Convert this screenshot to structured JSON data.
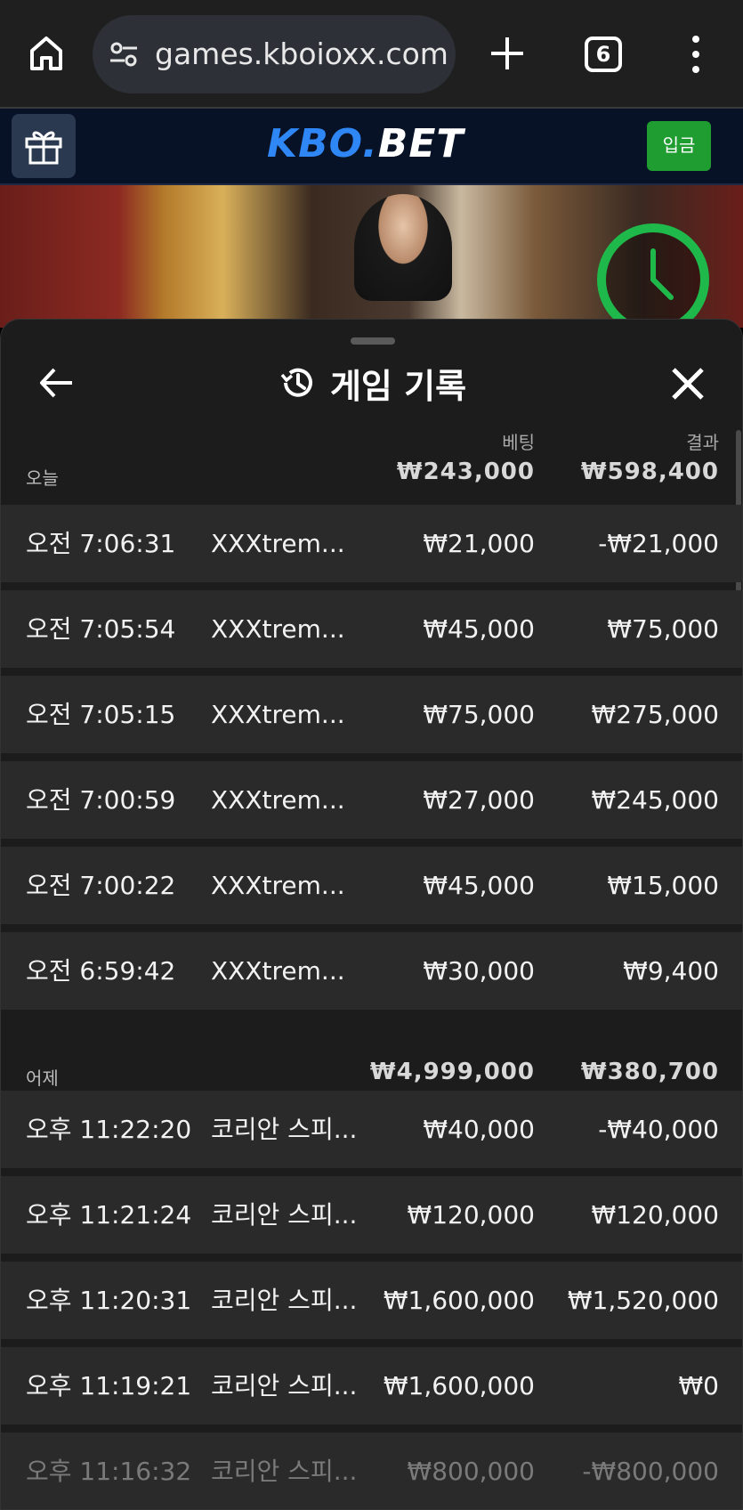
{
  "browser": {
    "url": "games.kboioxx.com/",
    "tab_count": "6"
  },
  "site": {
    "logo_part1": "KBO",
    "logo_dot": ".",
    "logo_part2": "BET",
    "deposit_label": "입금"
  },
  "history": {
    "title": "게임 기록",
    "col_bet": "베팅",
    "col_result": "결과",
    "groups": [
      {
        "label": "오늘",
        "total_bet": "₩243,000",
        "total_result": "₩598,400",
        "rows": [
          {
            "time": "오전 7:06:31",
            "game": "XXXtrem...",
            "bet": "₩21,000",
            "result": "-₩21,000"
          },
          {
            "time": "오전 7:05:54",
            "game": "XXXtrem...",
            "bet": "₩45,000",
            "result": "₩75,000"
          },
          {
            "time": "오전 7:05:15",
            "game": "XXXtrem...",
            "bet": "₩75,000",
            "result": "₩275,000"
          },
          {
            "time": "오전 7:00:59",
            "game": "XXXtrem...",
            "bet": "₩27,000",
            "result": "₩245,000"
          },
          {
            "time": "오전 7:00:22",
            "game": "XXXtrem...",
            "bet": "₩45,000",
            "result": "₩15,000"
          },
          {
            "time": "오전 6:59:42",
            "game": "XXXtrem...",
            "bet": "₩30,000",
            "result": "₩9,400"
          }
        ]
      },
      {
        "label": "어제",
        "total_bet": "₩4,999,000",
        "total_result": "₩380,700",
        "rows": [
          {
            "time": "오후 11:22:20",
            "game": "코리안 스피...",
            "bet": "₩40,000",
            "result": "-₩40,000"
          },
          {
            "time": "오후 11:21:24",
            "game": "코리안 스피...",
            "bet": "₩120,000",
            "result": "₩120,000"
          },
          {
            "time": "오후 11:20:31",
            "game": "코리안 스피...",
            "bet": "₩1,600,000",
            "result": "₩1,520,000"
          },
          {
            "time": "오후 11:19:21",
            "game": "코리안 스피...",
            "bet": "₩1,600,000",
            "result": "₩0"
          },
          {
            "time": "오후 11:16:32",
            "game": "코리안 스피...",
            "bet": "₩800,000",
            "result": "-₩800,000"
          }
        ]
      }
    ]
  },
  "colors": {
    "deposit_green": "#1f9d31",
    "logo_blue": "#2f86f5",
    "timer_green": "#1fb84a"
  }
}
